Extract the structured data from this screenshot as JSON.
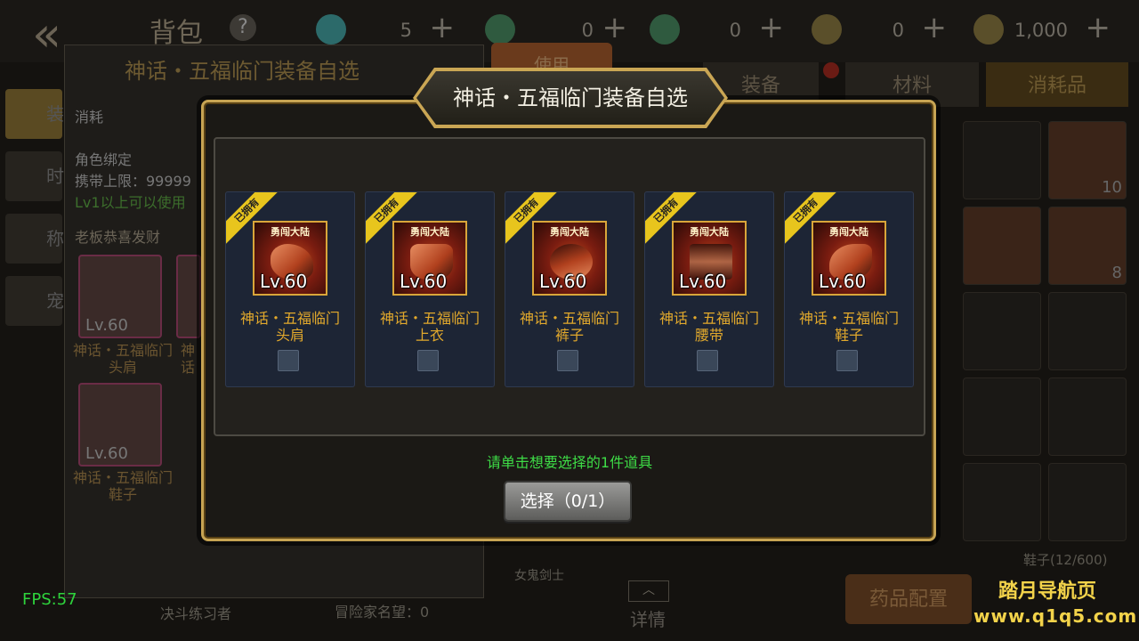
{
  "header": {
    "back_icon": "double-chevron-left-icon",
    "title": "背包",
    "help": "?",
    "resources": [
      {
        "icon": "gold-medal-icon",
        "value": "5",
        "plus": "+",
        "color": "#2c6a6a"
      },
      {
        "icon": "green-potion-icon",
        "value": "0",
        "plus": "+",
        "color": "#2f5a3f"
      },
      {
        "icon": "green-flask-icon",
        "value": "0",
        "plus": "+",
        "color": "#2f5a3f"
      },
      {
        "icon": "coin-icon",
        "value": "0",
        "plus": "+",
        "color": "#5a4f2a"
      },
      {
        "icon": "gold-coin-icon",
        "value": "1,000",
        "plus": "+",
        "color": "#5a4f2a"
      }
    ]
  },
  "sidebar": {
    "tabs": [
      {
        "label": "装"
      },
      {
        "label": "时"
      },
      {
        "label": "称"
      },
      {
        "label": "宠"
      }
    ]
  },
  "info_panel": {
    "title": "神话・五福临门装备自选",
    "type": "消耗",
    "bind": "角色绑定",
    "carry_limit": "携带上限：99999",
    "usable": "Lv1以上可以使用",
    "blessing": "老板恭喜发财",
    "items": [
      {
        "lv": "Lv.60",
        "name": "神话・五福临门头肩"
      },
      {
        "lv": "Lv.60",
        "name": "神话・五福临门鞋子"
      }
    ],
    "partial_name": "神话"
  },
  "right_panel": {
    "use_button": "使用",
    "tabs": [
      "装备",
      "材料",
      "消耗品"
    ],
    "slot_counts": [
      "10",
      "8"
    ],
    "shoes_count": "鞋子(12/600)",
    "potion_button": "药品配置",
    "detail_label": "详情"
  },
  "background_text": {
    "character_name": "决斗练习者",
    "fame": "冒险家名望：0",
    "class_label": "女鬼剑士"
  },
  "modal": {
    "title": "神话・五福临门装备自选",
    "owned_tag": "已拥有",
    "logo_text": "勇闯大陆",
    "items": [
      {
        "name_line1": "神话・五福临门",
        "name_line2": "头肩",
        "lv": "Lv.60",
        "checked": false
      },
      {
        "name_line1": "神话・五福临门",
        "name_line2": "上衣",
        "lv": "Lv.60",
        "checked": false
      },
      {
        "name_line1": "神话・五福临门",
        "name_line2": "裤子",
        "lv": "Lv.60",
        "checked": false
      },
      {
        "name_line1": "神话・五福临门",
        "name_line2": "腰带",
        "lv": "Lv.60",
        "checked": false
      },
      {
        "name_line1": "神话・五福临门",
        "name_line2": "鞋子",
        "lv": "Lv.60",
        "checked": false
      }
    ],
    "hint": "请单击想要选择的1件道具",
    "select_button": "选择（0/1）"
  },
  "overlay": {
    "fps": "FPS:57",
    "watermark_name": "踏月导航页",
    "watermark_url": "www.q1q5.com"
  }
}
